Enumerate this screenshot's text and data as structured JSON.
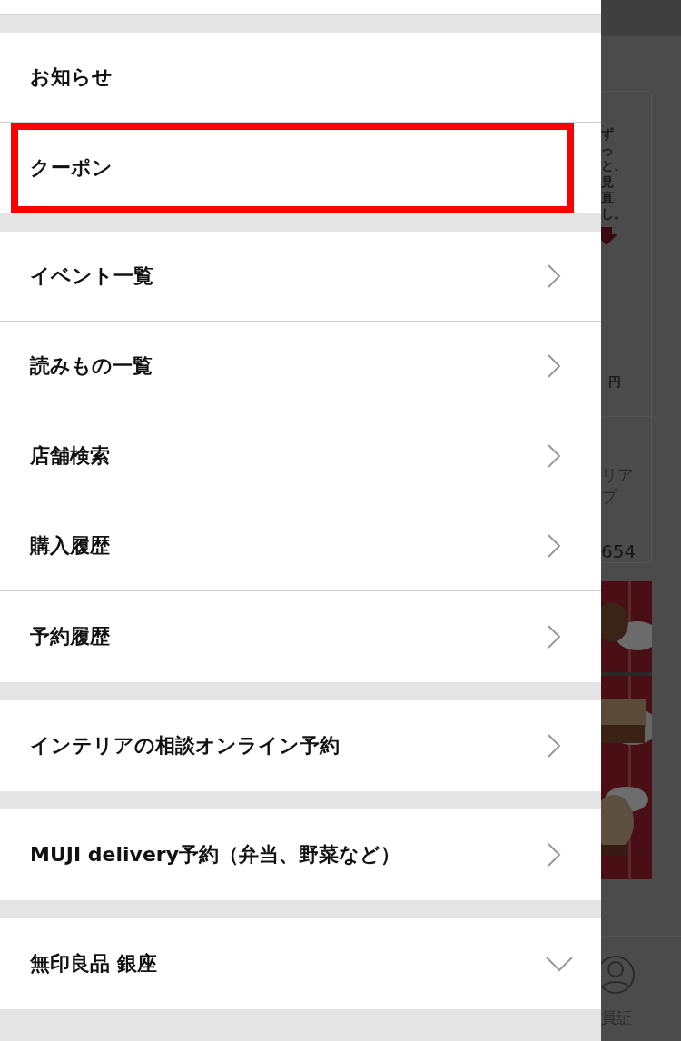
{
  "menu": {
    "groups": [
      {
        "items": [
          {
            "label": "お知らせ",
            "kind": "plain",
            "highlighted": false
          },
          {
            "label": "クーポン",
            "kind": "plain",
            "highlighted": true
          }
        ]
      },
      {
        "items": [
          {
            "label": "イベント一覧",
            "kind": "link",
            "highlighted": false
          },
          {
            "label": "読みもの一覧",
            "kind": "link",
            "highlighted": false
          },
          {
            "label": "店舗検索",
            "kind": "link",
            "highlighted": false
          },
          {
            "label": "購入履歴",
            "kind": "link",
            "highlighted": false
          },
          {
            "label": "予約履歴",
            "kind": "link",
            "highlighted": false
          }
        ]
      },
      {
        "items": [
          {
            "label": "インテリアの相談オンライン予約",
            "kind": "link",
            "highlighted": false
          }
        ]
      },
      {
        "items": [
          {
            "label": "MUJI delivery予約（弁当、野菜など）",
            "kind": "link",
            "highlighted": false
          }
        ]
      },
      {
        "items": [
          {
            "label": "無印良品 銀座",
            "kind": "expand",
            "highlighted": false
          }
        ]
      }
    ]
  },
  "background_page": {
    "banner_text": "ずっと、見直し。",
    "price_unit": "円",
    "store_lines": [
      "リア",
      "プ"
    ],
    "number": "654",
    "tab_label": "員証"
  }
}
